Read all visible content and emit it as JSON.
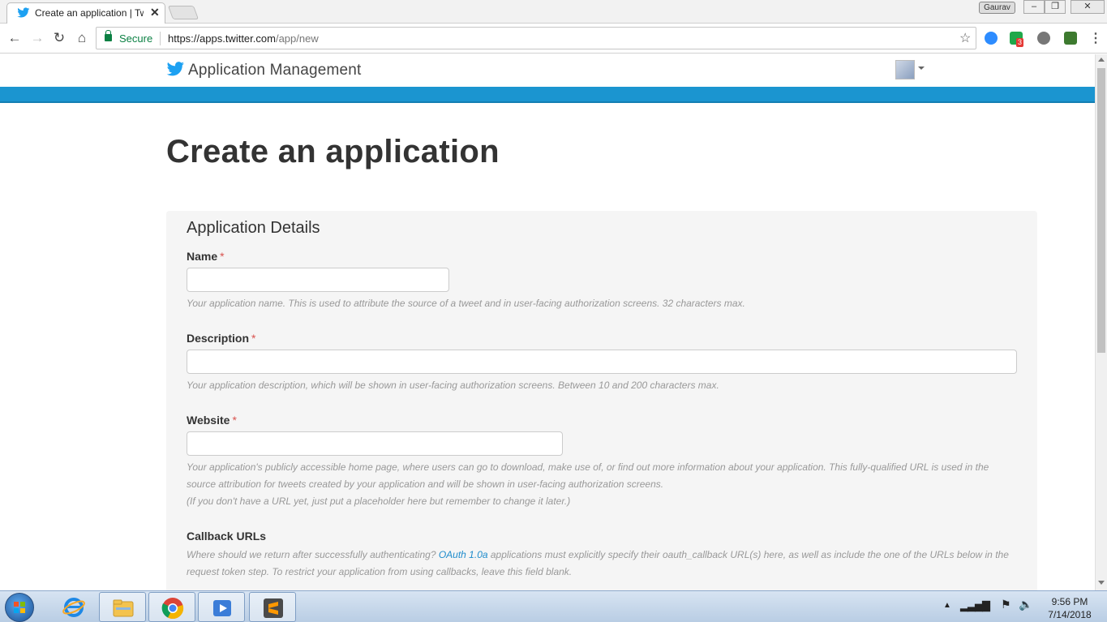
{
  "browser": {
    "tab_title": "Create an application | Tw",
    "profile_name": "Gaurav",
    "secure_label": "Secure",
    "url_scheme_host": "https://apps.twitter.com",
    "url_path": "/app/new",
    "extension_badge": "3"
  },
  "header": {
    "brand": "Application Management"
  },
  "page": {
    "title": "Create an application"
  },
  "form": {
    "section_title": "Application Details",
    "name_label": "Name",
    "name_help": "Your application name. This is used to attribute the source of a tweet and in user-facing authorization screens. 32 characters max.",
    "description_label": "Description",
    "description_help": "Your application description, which will be shown in user-facing authorization screens. Between 10 and 200 characters max.",
    "website_label": "Website",
    "website_help_1": "Your application's publicly accessible home page, where users can go to download, make use of, or find out more information about your application. This fully-qualified URL is used in the",
    "website_help_2": "source attribution for tweets created by your application and will be shown in user-facing authorization screens.",
    "website_help_3": "(If you don't have a URL yet, just put a placeholder here but remember to change it later.)",
    "callback_label": "Callback URLs",
    "callback_help_pre": "Where should we return after successfully authenticating? ",
    "callback_help_link": "OAuth 1.0a",
    "callback_help_post": " applications must explicitly specify their oauth_callback URL(s) here, as well as include the one of the URLs below in the",
    "callback_help_2": "request token step. To restrict your application from using callbacks, leave this field blank.",
    "required_mark": "*"
  },
  "taskbar": {
    "time": "9:56 PM",
    "date": "7/14/2018"
  },
  "colors": {
    "twitter_blue": "#1b95d0",
    "required_red": "#d9534f",
    "link_blue": "#1f8ccc"
  }
}
